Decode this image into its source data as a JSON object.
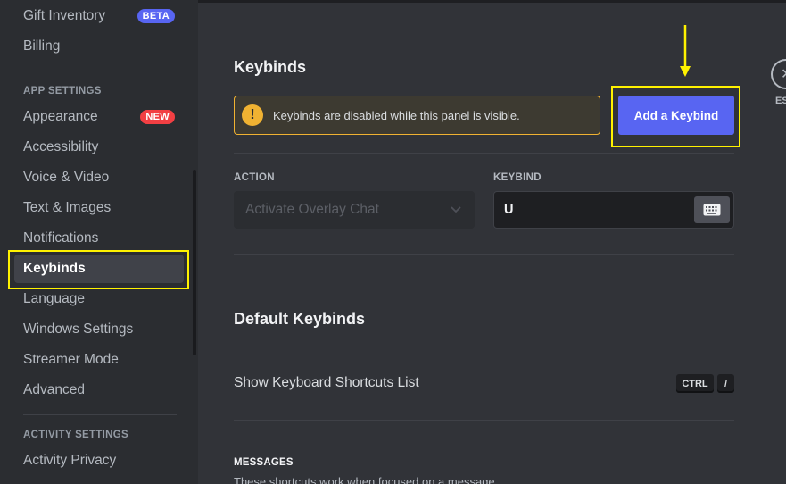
{
  "sidebar": {
    "items": [
      {
        "label": "Gift Inventory",
        "badge": "BETA"
      },
      {
        "label": "Billing"
      },
      {
        "label": "Appearance",
        "badge": "NEW"
      },
      {
        "label": "Accessibility"
      },
      {
        "label": "Voice & Video"
      },
      {
        "label": "Text & Images"
      },
      {
        "label": "Notifications"
      },
      {
        "label": "Keybinds",
        "selected": true
      },
      {
        "label": "Language"
      },
      {
        "label": "Windows Settings"
      },
      {
        "label": "Streamer Mode"
      },
      {
        "label": "Advanced"
      },
      {
        "label": "Activity Privacy"
      }
    ],
    "headers": {
      "app_settings": "APP SETTINGS",
      "activity_settings": "ACTIVITY SETTINGS"
    }
  },
  "main": {
    "title": "Keybinds",
    "warning": "Keybinds are disabled while this panel is visible.",
    "warning_icon": "!",
    "add_button": "Add a Keybind",
    "action_label": "ACTION",
    "action_value": "Activate Overlay Chat",
    "keybind_label": "KEYBIND",
    "keybind_value": "U",
    "default_title": "Default Keybinds",
    "shortcut_label": "Show Keyboard Shortcuts List",
    "shortcut_keys": [
      "CTRL",
      "/"
    ],
    "messages_title": "MESSAGES",
    "messages_desc": "These shortcuts work when focused on a message."
  },
  "close": {
    "label": "ESC",
    "icon": "close-icon"
  },
  "colors": {
    "accent": "#5865f2",
    "highlight": "#fff200",
    "warning": "#f0b232",
    "new_badge": "#f23f43"
  }
}
